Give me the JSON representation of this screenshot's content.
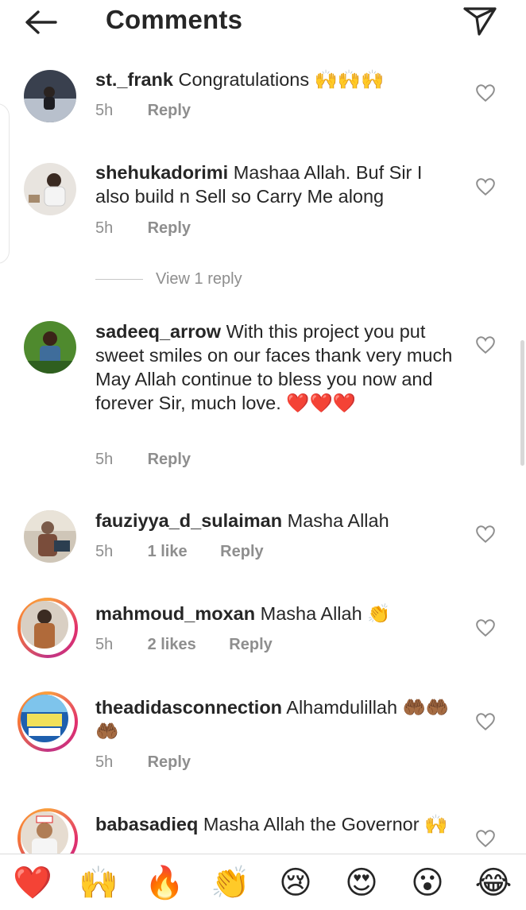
{
  "header": {
    "title": "Comments",
    "back_icon": "arrow-left-icon",
    "share_icon": "paper-plane-icon"
  },
  "comments": [
    {
      "username": "st._frank",
      "text": "Congratulations 🙌🙌🙌",
      "time": "5h",
      "likes": "",
      "reply": "Reply"
    },
    {
      "username": "shehukadorimi",
      "text": "Mashaa Allah. Buf Sir I also build n Sell so Carry Me along",
      "time": "5h",
      "likes": "",
      "reply": "Reply"
    },
    {
      "username": "sadeeq_arrow",
      "text": "With this project you put sweet smiles on our faces thank very much May Allah continue to bless you now and forever Sir, much love. ❤️❤️❤️",
      "time": "5h",
      "likes": "",
      "reply": "Reply"
    },
    {
      "username": "fauziyya_d_sulaiman",
      "text": "Masha Allah",
      "time": "5h",
      "likes": "1 like",
      "reply": "Reply"
    },
    {
      "username": "mahmoud_moxan",
      "text": "Masha Allah 👏",
      "time": "5h",
      "likes": "2 likes",
      "reply": "Reply"
    },
    {
      "username": "theadidasconnection",
      "text": "Alhamdulillah 🤲🏾🤲🏾🤲🏾",
      "time": "5h",
      "likes": "",
      "reply": "Reply"
    },
    {
      "username": "babasadieq",
      "text": "Masha Allah the Governor 🙌",
      "time": "",
      "likes": "",
      "reply": ""
    }
  ],
  "view_replies": "View 1 reply",
  "emoji_bar": [
    "❤️",
    "🙌",
    "🔥",
    "👏",
    "😢",
    "😍",
    "😮",
    "😂"
  ],
  "colors": {
    "text": "#262626",
    "muted": "#8e8e8e",
    "story_ring": "#e1306c"
  }
}
